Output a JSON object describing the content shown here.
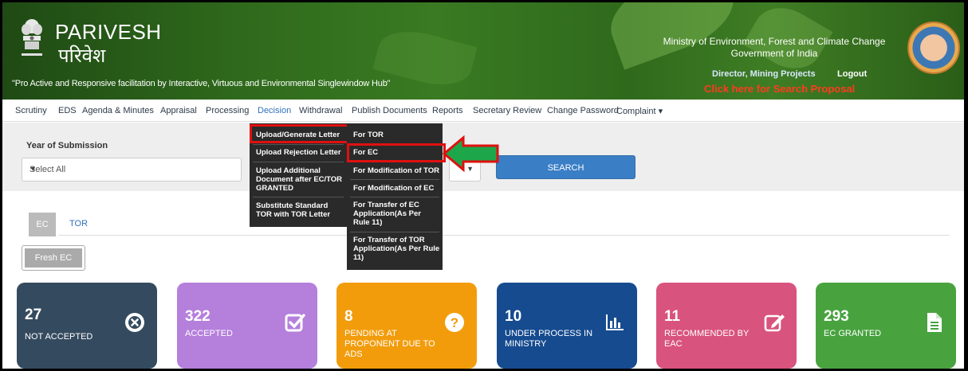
{
  "header": {
    "brand_en": "PARIVESH",
    "brand_hi": "परिवेश",
    "tagline": "\"Pro Active and Responsive facilitation by Interactive, Virtuous and Environmental Singlewindow Hub\"",
    "ministry_line1": "Ministry of Environment, Forest and Climate Change",
    "ministry_line2": "Government of India",
    "role": "Director, Mining Projects",
    "logout": "Logout",
    "search_proposal": "Click here for Search Proposal"
  },
  "nav": {
    "items": [
      "Scrutiny",
      "EDS",
      "Agenda & Minutes",
      "Appraisal",
      "Processing",
      "Decision",
      "Withdrawal",
      "Publish Documents",
      "Reports",
      "Secretary Review",
      "Change Password",
      "Complaint ▾"
    ],
    "active": "Decision"
  },
  "filter": {
    "year_label": "Year of Submission",
    "year_value": "Select All",
    "search_button": "SEARCH"
  },
  "tabs": {
    "ec": "EC",
    "tor": "TOR",
    "fresh_ec": "Fresh EC"
  },
  "decision_menu": {
    "items": [
      "Upload/Generate Letter",
      "Upload Rejection Letter",
      "Upload Additional Document after EC/TOR GRANTED",
      "Substitute Standard TOR with TOR Letter"
    ]
  },
  "letter_submenu": {
    "items": [
      "For TOR",
      "For EC",
      "For Modification of TOR",
      "For Modification of EC",
      "For Transfer of EC Application(As Per Rule 11)",
      "For Transfer of TOR Application(As Per Rule 11)"
    ]
  },
  "cards": [
    {
      "count": "27",
      "label": "NOT ACCEPTED",
      "color": "#344a5f",
      "icon": "times-circle-icon"
    },
    {
      "count": "322",
      "label": "ACCEPTED",
      "color": "#b57fdc",
      "icon": "check-square-icon"
    },
    {
      "count": "8",
      "label": "PENDING AT PROPONENT DUE TO ADS",
      "color": "#f29c0c",
      "icon": "question-circle-icon"
    },
    {
      "count": "10",
      "label": "UNDER PROCESS IN MINISTRY",
      "color": "#164b8f",
      "icon": "bar-chart-icon"
    },
    {
      "count": "11",
      "label": "RECOMMENDED BY EAC",
      "color": "#d9537f",
      "icon": "edit-icon"
    },
    {
      "count": "293",
      "label": "EC GRANTED",
      "color": "#48a33f",
      "icon": "file-icon"
    }
  ],
  "highlight_colors": {
    "box": "#e01010",
    "arrow": "#1ea64a"
  }
}
